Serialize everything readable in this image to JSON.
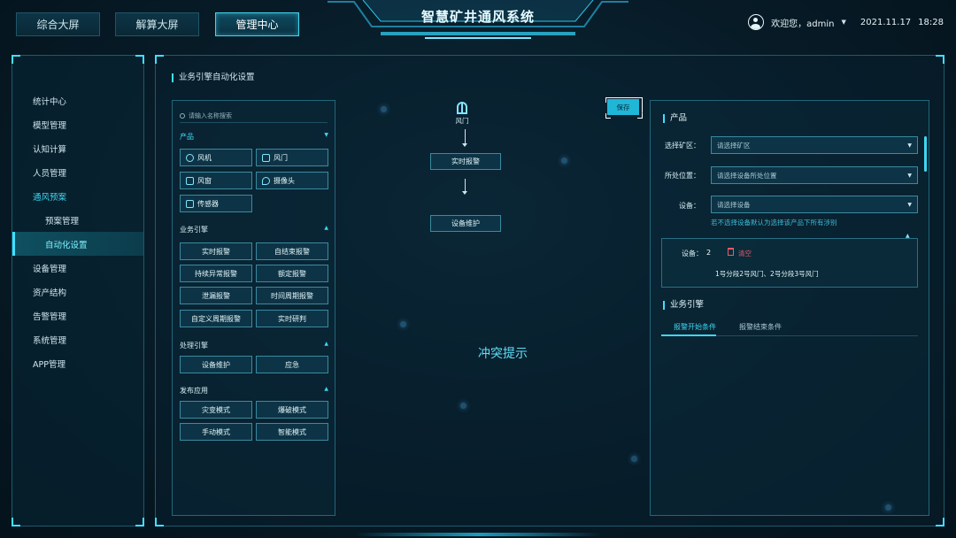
{
  "header": {
    "tabs": [
      {
        "label": "综合大屏"
      },
      {
        "label": "解算大屏"
      },
      {
        "label": "管理中心",
        "active": true
      }
    ],
    "title": "智慧矿井通风系统",
    "user": "欢迎您，admin",
    "date": "2021.11.17",
    "time": "18:28"
  },
  "sidebar": {
    "items": [
      {
        "label": "统计中心"
      },
      {
        "label": "模型管理"
      },
      {
        "label": "认知计算"
      },
      {
        "label": "人员管理"
      },
      {
        "label": "通风预案"
      },
      {
        "label": "预案管理"
      },
      {
        "label": "自动化设置"
      },
      {
        "label": "设备管理"
      },
      {
        "label": "资产结构"
      },
      {
        "label": "告警管理"
      },
      {
        "label": "系统管理"
      },
      {
        "label": "APP管理"
      }
    ]
  },
  "main": {
    "title": "业务引擎自动化设置",
    "search_placeholder": "请输入名称搜索",
    "sections": {
      "product": {
        "title": "产品",
        "items": [
          {
            "label": "风机",
            "icon": "fan-icon"
          },
          {
            "label": "风门",
            "icon": "door-icon"
          },
          {
            "label": "风窗",
            "icon": "window-icon"
          },
          {
            "label": "摄像头",
            "icon": "camera-icon"
          },
          {
            "label": "传感器",
            "icon": "sensor-icon"
          }
        ]
      },
      "engine": {
        "title": "业务引擎",
        "items": [
          "实时报警",
          "自结束报警",
          "持续异常报警",
          "额定报警",
          "泄漏报警",
          "时间周期报警",
          "自定义周期报警",
          "实时研判"
        ]
      },
      "process": {
        "title": "处理引擎",
        "items": [
          "设备维护",
          "应急"
        ]
      },
      "publish": {
        "title": "发布应用",
        "items": [
          "灾变模式",
          "爆破模式",
          "手动模式",
          "智能模式"
        ]
      }
    },
    "flow": {
      "start": "风门",
      "node1": "实时报警",
      "node2": "设备维护",
      "conflict": "冲突提示"
    },
    "save": "保存"
  },
  "props": {
    "product_title": "产品",
    "area_label": "选择矿区：",
    "area_placeholder": "请选择矿区",
    "location_label": "所处位置：",
    "location_placeholder": "请选择设备所处位置",
    "device_label": "设备：",
    "device_placeholder": "请选择设备",
    "hint": "若不选择设备默认为选择该产品下所有涉别",
    "selected_label": "设备：",
    "selected_count": "2",
    "clear": "清空",
    "selected_list": "1号分段2号风门、2号分段3号风门",
    "engine_title": "业务引擎",
    "tab_start": "报警开始条件",
    "tab_end": "报警结束条件"
  },
  "colors": {
    "accent": "#3fd6f0",
    "panel_border": "#22667a",
    "danger": "#e85a6a"
  }
}
